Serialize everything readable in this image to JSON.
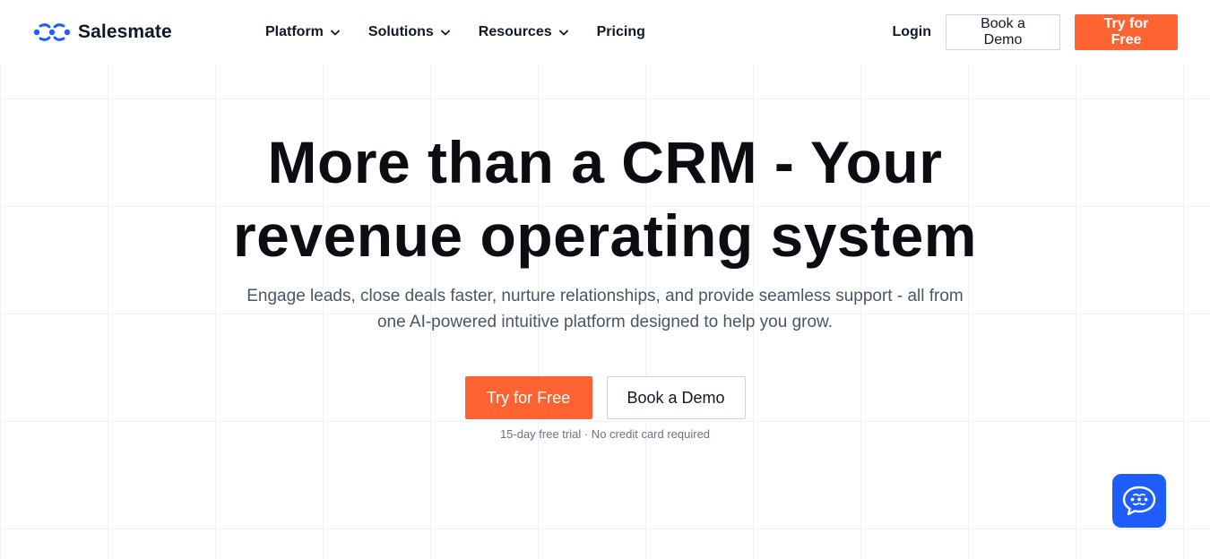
{
  "brand": {
    "name": "Salesmate",
    "logo_icon": "salesmate-logo-icon",
    "color": "#1e5eff"
  },
  "nav": {
    "items": [
      {
        "label": "Platform",
        "has_dropdown": true
      },
      {
        "label": "Solutions",
        "has_dropdown": true
      },
      {
        "label": "Resources",
        "has_dropdown": true
      },
      {
        "label": "Pricing",
        "has_dropdown": false
      }
    ]
  },
  "header_actions": {
    "login_label": "Login",
    "demo_label": "Book a Demo",
    "trial_label": "Try for Free"
  },
  "hero": {
    "title_line1": "More than a CRM - Your",
    "title_line2": "revenue operating system",
    "subtitle_line1": "Engage leads, close deals faster, nurture relationships, and provide seamless support - all from",
    "subtitle_line2": "one AI-powered intuitive platform designed to help you grow.",
    "primary_cta": "Try for Free",
    "secondary_cta": "Book a Demo",
    "note": "15-day free trial · No credit card required"
  },
  "chat_widget": {
    "icon": "chat-bubble-icon"
  },
  "colors": {
    "accent": "#ff6331",
    "brand": "#1e5eff",
    "text": "#0b0d12",
    "muted": "#4b5563"
  }
}
